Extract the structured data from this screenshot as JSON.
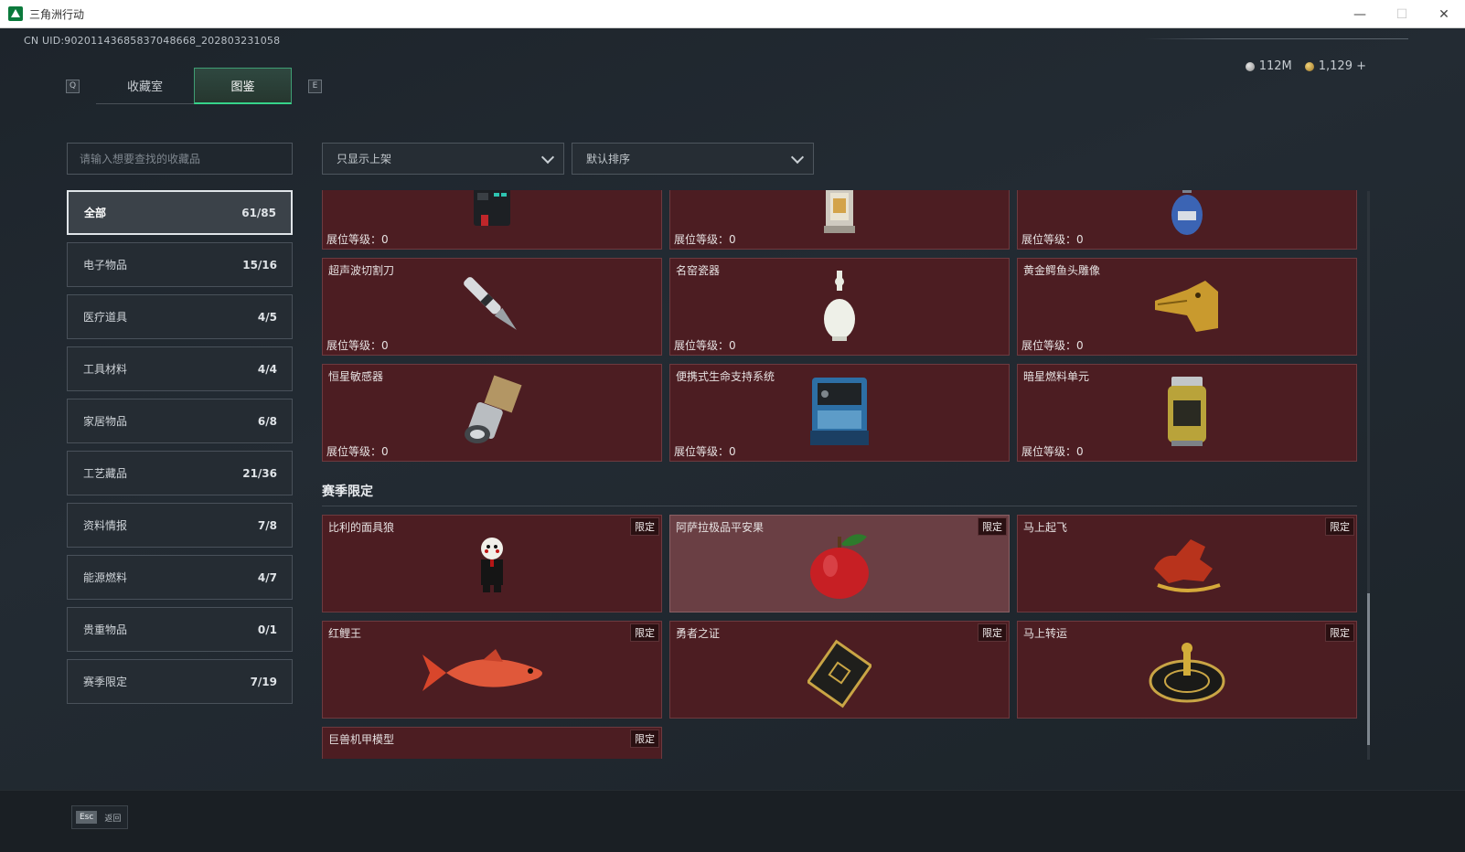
{
  "window": {
    "title": "三角洲行动",
    "min": "—",
    "max": "☐",
    "close": "✕"
  },
  "uid": "CN UID:9020114368583704866​8_202803231058",
  "tabs": {
    "prev_key": "Q",
    "next_key": "E",
    "items": [
      "收藏室",
      "图鉴"
    ],
    "active": "图鉴"
  },
  "currency": {
    "silver": "112M",
    "gold": "1,129 +"
  },
  "search": {
    "placeholder": "请输入想要查找的收藏品"
  },
  "filters": {
    "shelf": "只显示上架",
    "sort": "默认排序"
  },
  "sidebar": {
    "items": [
      {
        "label": "全部",
        "count": "61/85"
      },
      {
        "label": "电子物品",
        "count": "15/16"
      },
      {
        "label": "医疗道具",
        "count": "4/5"
      },
      {
        "label": "工具材料",
        "count": "4/4"
      },
      {
        "label": "家居物品",
        "count": "6/8"
      },
      {
        "label": "工艺藏品",
        "count": "21/36"
      },
      {
        "label": "资料情报",
        "count": "7/8"
      },
      {
        "label": "能源燃料",
        "count": "4/7"
      },
      {
        "label": "贵重物品",
        "count": "0/1"
      },
      {
        "label": "赛季限定",
        "count": "7/19"
      }
    ]
  },
  "level_label": "展位等级：",
  "level_value": "0",
  "limited_badge": "限定",
  "cards_top": [
    {
      "name": "",
      "icon": "device-icon"
    },
    {
      "name": "",
      "icon": "lantern-icon"
    },
    {
      "name": "",
      "icon": "gas-canister-icon"
    },
    {
      "name": "超声波切割刀",
      "icon": "scalpel-icon"
    },
    {
      "name": "名窑瓷器",
      "icon": "vase-icon"
    },
    {
      "name": "黄金鳄鱼头雕像",
      "icon": "gold-crocodile-icon"
    },
    {
      "name": "恒星敏感器",
      "icon": "sensor-icon"
    },
    {
      "name": "便携式生命支持系统",
      "icon": "life-support-icon"
    },
    {
      "name": "暗星燃料单元",
      "icon": "fuel-cell-icon"
    }
  ],
  "section_title": "赛季限定",
  "cards_season": [
    {
      "name": "比利的面具狼",
      "icon": "puppet-icon"
    },
    {
      "name": "阿萨拉极品平安果",
      "icon": "apple-icon"
    },
    {
      "name": "马上起飞",
      "icon": "horse-icon"
    },
    {
      "name": "红鲤王",
      "icon": "carp-icon"
    },
    {
      "name": "勇者之证",
      "icon": "card-icon"
    },
    {
      "name": "马上转运",
      "icon": "wheel-icon"
    },
    {
      "name": "巨兽机甲模型",
      "icon": "mecha-icon"
    }
  ],
  "bottom": {
    "key": "Esc",
    "label": "返回"
  },
  "colors": {
    "card_bg": "#4c1d22",
    "accent": "#36d38a"
  }
}
